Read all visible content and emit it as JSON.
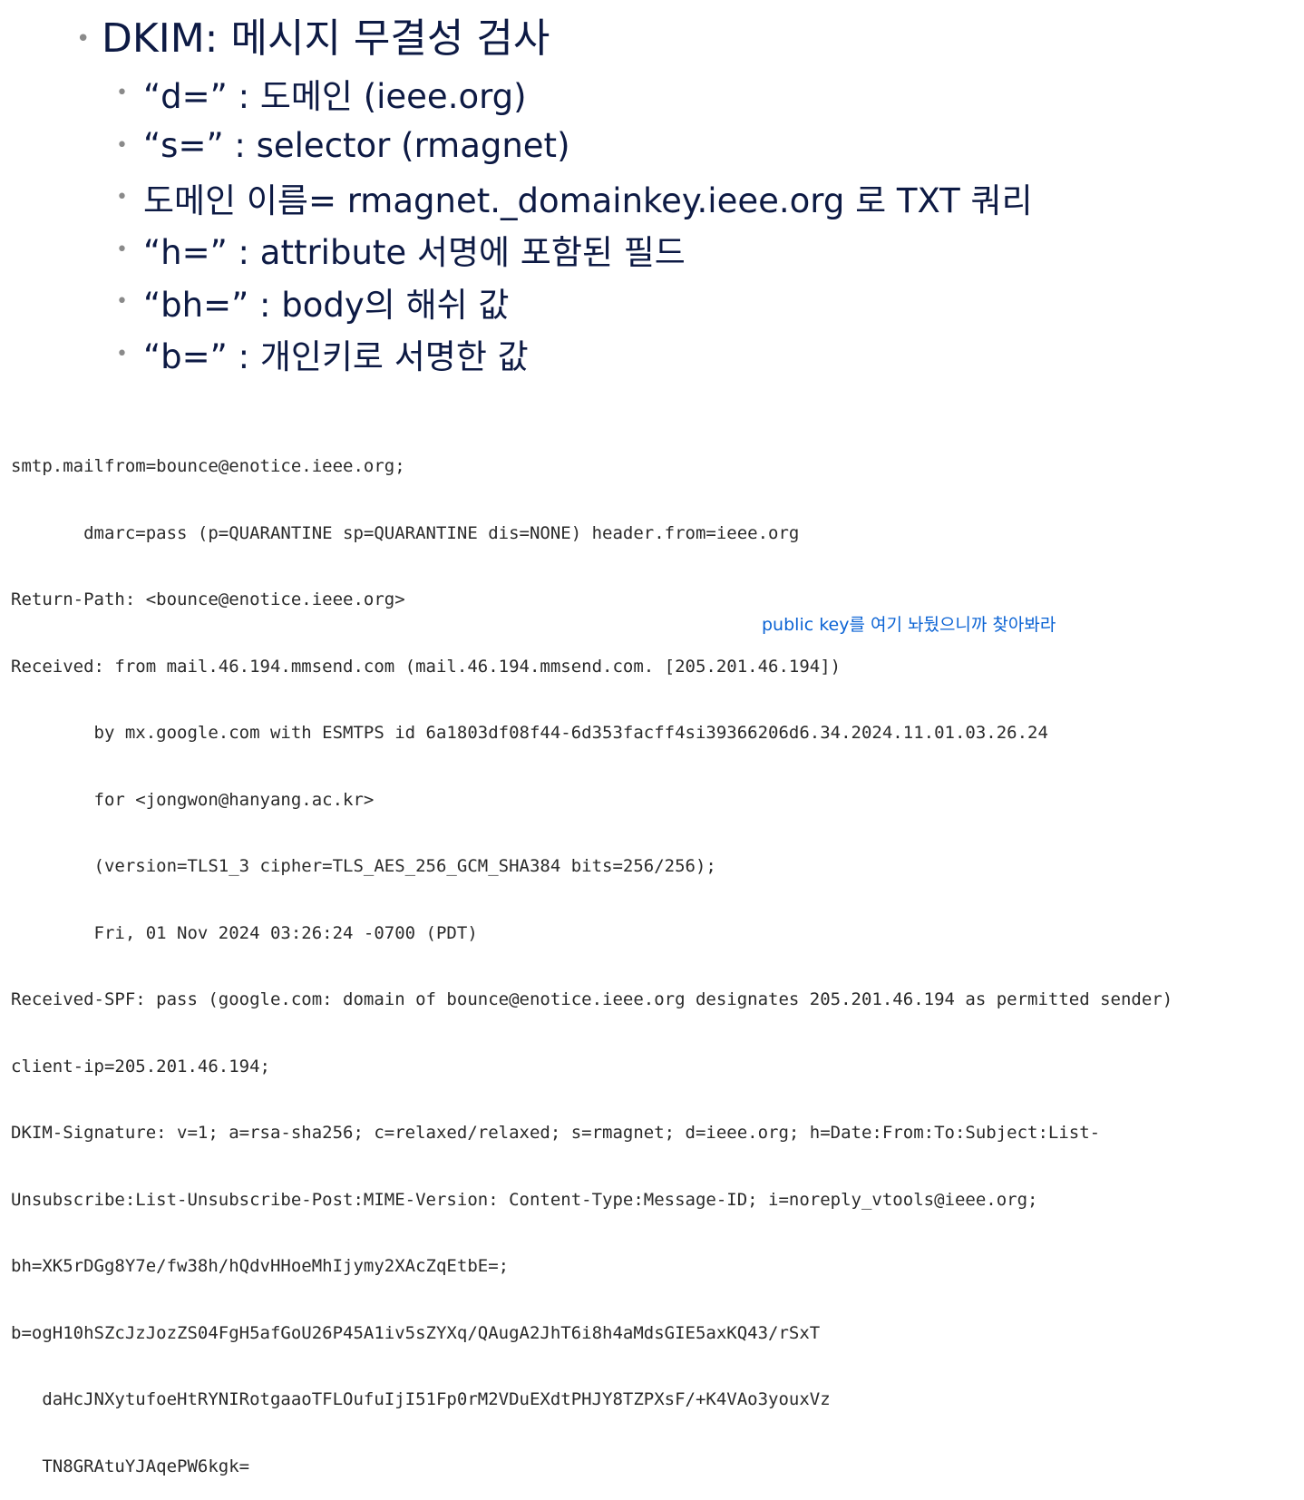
{
  "slide": {
    "main_bullet": "DKIM: 메시지 무결성 검사",
    "sub_bullets": [
      "“d=” : 도메인 (ieee.org)",
      "“s=” : selector (rmagnet)",
      "도메인 이름= rmagnet._domainkey.ieee.org 로 TXT 쿼리",
      "“h=” : attribute 서명에 포함된 필드",
      "“bh=” : body의 해쉬 값",
      "“b=” : 개인키로 서명한 값"
    ],
    "bullet_glyph": "•"
  },
  "header_dump": {
    "lines": [
      "smtp.mailfrom=bounce@enotice.ieee.org;",
      "       dmarc=pass (p=QUARANTINE sp=QUARANTINE dis=NONE) header.from=ieee.org",
      "Return-Path: <bounce@enotice.ieee.org>",
      "Received: from mail.46.194.mmsend.com (mail.46.194.mmsend.com. [205.201.46.194])",
      "        by mx.google.com with ESMTPS id 6a1803df08f44-6d353facff4si39366206d6.34.2024.11.01.03.26.24",
      "        for <jongwon@hanyang.ac.kr>",
      "        (version=TLS1_3 cipher=TLS_AES_256_GCM_SHA384 bits=256/256);",
      "        Fri, 01 Nov 2024 03:26:24 -0700 (PDT)",
      "Received-SPF: pass (google.com: domain of bounce@enotice.ieee.org designates 205.201.46.194 as permitted sender)",
      "client-ip=205.201.46.194;",
      "DKIM-Signature: v=1; a=rsa-sha256; c=relaxed/relaxed; s=rmagnet; d=ieee.org; h=Date:From:To:Subject:List-",
      "Unsubscribe:List-Unsubscribe-Post:MIME-Version: Content-Type:Message-ID; i=noreply_vtools@ieee.org;",
      "bh=XK5rDGg8Y7e/fw38h/hQdvHHoeMhIjymy2XAcZqEtbE=;",
      "b=ogH10hSZcJzJozZS04FgH5afGoU26P45A1iv5sZYXq/QAugA2JhT6i8h4aMdsGIE5axKQ43/rSxT",
      "   daHcJNXytufoeHtRYNIRotgaaoTFLOufuIjI51Fp0rM2VDuEXdtPHJY8TZPXsF/+K4VAo3youxVz",
      "   TN8GRAtuYJAqePW6kgk="
    ],
    "annotation": "public key를 여기 놔뒀으니까 찾아봐라"
  },
  "colors": {
    "slide_text": "#0d1a44",
    "bullet": "#8a8a8a",
    "mono_text": "#2a2a2a",
    "annotation": "#0b63d4"
  }
}
